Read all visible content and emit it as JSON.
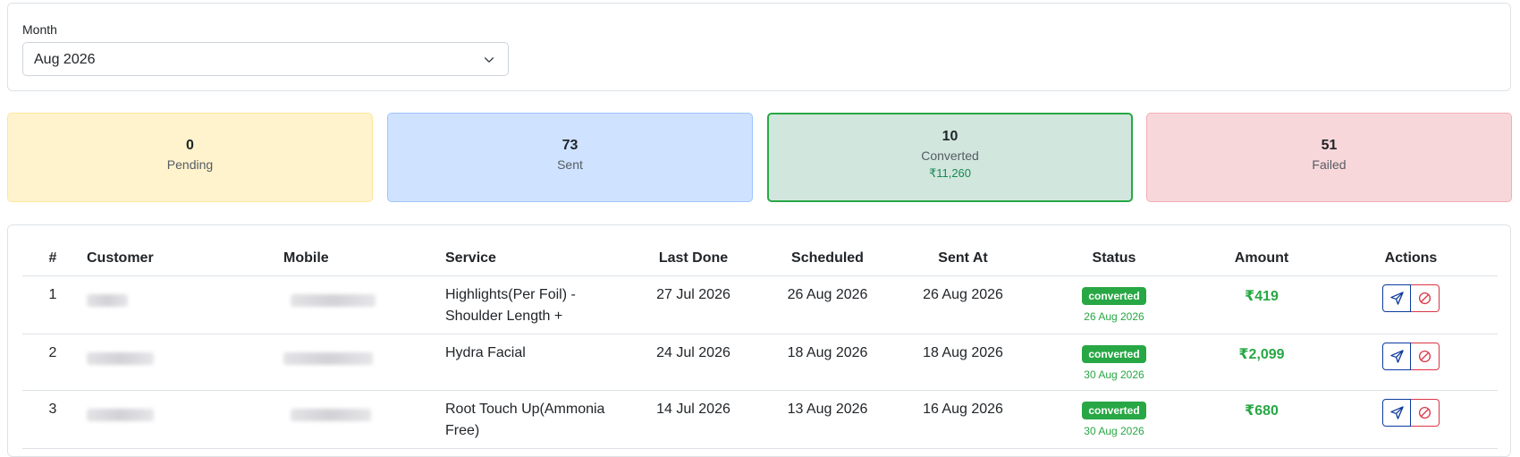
{
  "filter": {
    "label": "Month",
    "selected": "Aug 2026"
  },
  "stats": {
    "pending": {
      "count": "0",
      "label": "Pending"
    },
    "sent": {
      "count": "73",
      "label": "Sent"
    },
    "converted": {
      "count": "10",
      "label": "Converted",
      "amount": "₹11,260"
    },
    "failed": {
      "count": "51",
      "label": "Failed"
    }
  },
  "table": {
    "headers": [
      "#",
      "Customer",
      "Mobile",
      "Service",
      "Last Done",
      "Scheduled",
      "Sent At",
      "Status",
      "Amount",
      "Actions"
    ],
    "rows": [
      {
        "index": "1",
        "service": "Highlights(Per Foil) - Shoulder Length +",
        "last_done": "27 Jul 2026",
        "scheduled": "26 Aug 2026",
        "sent_at": "26 Aug 2026",
        "status": "converted",
        "converted_on": "26 Aug 2026",
        "amount": "₹419"
      },
      {
        "index": "2",
        "service": "Hydra Facial",
        "last_done": "24 Jul 2026",
        "scheduled": "18 Aug 2026",
        "sent_at": "18 Aug 2026",
        "status": "converted",
        "converted_on": "30 Aug 2026",
        "amount": "₹2,099"
      },
      {
        "index": "3",
        "service": "Root Touch Up(Ammonia Free)",
        "last_done": "14 Jul 2026",
        "scheduled": "13 Aug 2026",
        "sent_at": "16 Aug 2026",
        "status": "converted",
        "converted_on": "30 Aug 2026",
        "amount": "₹680"
      }
    ]
  },
  "icons": {
    "select": "chevron-down-icon",
    "send": "send-icon",
    "cancel": "cancel-icon"
  },
  "colors": {
    "success": "#28a745",
    "primary": "#0d3b9e",
    "danger": "#dc3545",
    "pending_bg": "#fff3cd",
    "sent_bg": "#cfe2ff",
    "converted_bg": "#d1e7dd",
    "failed_bg": "#f8d7da"
  }
}
